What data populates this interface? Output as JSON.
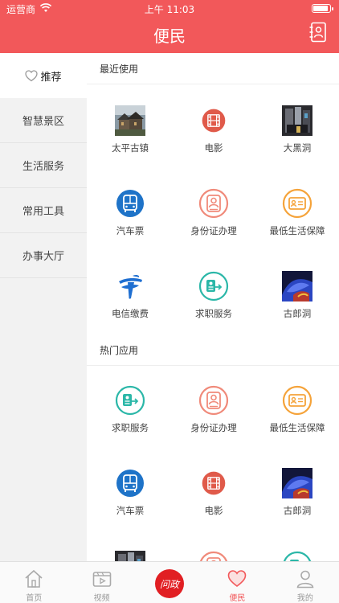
{
  "status_bar": {
    "carrier": "运营商",
    "time": "上午 11:03",
    "battery_level": 0.9
  },
  "header": {
    "title": "便民"
  },
  "sidebar": {
    "items": [
      {
        "label": "推荐"
      },
      {
        "label": "智慧景区"
      },
      {
        "label": "生活服务"
      },
      {
        "label": "常用工具"
      },
      {
        "label": "办事大厅"
      }
    ]
  },
  "sections": {
    "recent": {
      "title": "最近使用",
      "items": [
        {
          "label": "太平古镇",
          "icon": "town-photo"
        },
        {
          "label": "电影",
          "icon": "film-icon"
        },
        {
          "label": "大黑洞",
          "icon": "cave-photo"
        },
        {
          "label": "汽车票",
          "icon": "bus-icon"
        },
        {
          "label": "身份证办理",
          "icon": "id-card-person-icon"
        },
        {
          "label": "最低生活保障",
          "icon": "id-card-icon"
        },
        {
          "label": "电信缴费",
          "icon": "china-telecom-icon"
        },
        {
          "label": "求职服务",
          "icon": "job-service-icon"
        },
        {
          "label": "古郎洞",
          "icon": "cave-colorful-photo"
        }
      ]
    },
    "hot": {
      "title": "热门应用",
      "items": [
        {
          "label": "求职服务",
          "icon": "job-service-icon"
        },
        {
          "label": "身份证办理",
          "icon": "id-card-person-icon"
        },
        {
          "label": "最低生活保障",
          "icon": "id-card-icon"
        },
        {
          "label": "汽车票",
          "icon": "bus-icon"
        },
        {
          "label": "电影",
          "icon": "film-icon"
        },
        {
          "label": "古郎洞",
          "icon": "cave-colorful-photo"
        },
        {
          "label": "",
          "icon": "cave-photo"
        },
        {
          "label": "",
          "icon": "id-card-person-icon"
        },
        {
          "label": "",
          "icon": "job-service-icon"
        }
      ]
    }
  },
  "tabbar": {
    "items": [
      {
        "label": "首页"
      },
      {
        "label": "视频"
      },
      {
        "label": "",
        "badge": "问政"
      },
      {
        "label": "便民"
      },
      {
        "label": "我的"
      }
    ]
  },
  "colors": {
    "brand": "#f2585a",
    "film": "#e05a4a",
    "bus": "#1e73c8",
    "job": "#2bb7a8",
    "id_card": "#f08a7a",
    "welfare": "#f5a33a"
  }
}
